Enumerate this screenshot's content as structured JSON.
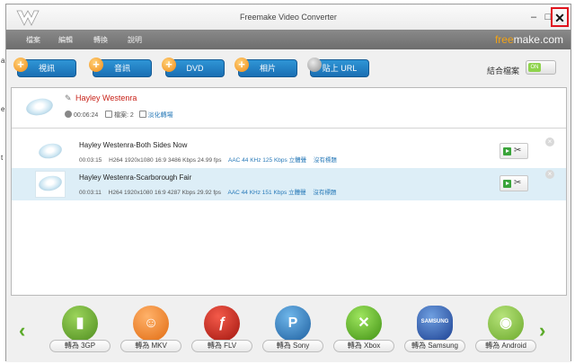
{
  "window": {
    "title": "Freemake Video Converter",
    "close_highlight_color": "#e0141e"
  },
  "menu": {
    "items": [
      "檔案",
      "編輯",
      "轉換",
      "說明"
    ],
    "brand_left": "free",
    "brand_right": "make.com"
  },
  "toolbar": {
    "buttons": [
      {
        "label": "視訊",
        "icon": "plus-icon"
      },
      {
        "label": "音訊",
        "icon": "plus-icon"
      },
      {
        "label": "DVD",
        "icon": "plus-icon"
      },
      {
        "label": "相片",
        "icon": "plus-icon"
      }
    ],
    "url_button": "貼上 URL",
    "join_label": "結合檔案",
    "join_toggle_state": "ON"
  },
  "group": {
    "title": "Hayley Westenra",
    "duration": "00:06:24",
    "files_label": "檔案: 2",
    "fade_link": "淡化轉場"
  },
  "files": [
    {
      "title": "Hayley Westenra-Both Sides Now",
      "duration": "00:03:15",
      "video": "H264  1920x1080  16:9  3486 Kbps  24.99 fps",
      "audio": "AAC  44 KHz  125 Kbps  立體聲",
      "subtitle": "沒有標題",
      "selected": false
    },
    {
      "title": "Hayley Westenra-Scarborough Fair",
      "duration": "00:03:11",
      "video": "H264  1920x1080  16:9  4287 Kbps  29.92 fps",
      "audio": "AAC  44 KHz  151 Kbps  立體聲",
      "subtitle": "沒有標題",
      "selected": true
    }
  ],
  "converters": [
    {
      "label": "轉為 3GP",
      "icon": "3gp-phone-icon"
    },
    {
      "label": "轉為 MKV",
      "icon": "mkv-matryoshka-icon"
    },
    {
      "label": "轉為 FLV",
      "icon": "flash-icon"
    },
    {
      "label": "轉為 Sony",
      "icon": "playstation-icon"
    },
    {
      "label": "轉為 Xbox",
      "icon": "xbox-icon"
    },
    {
      "label": "轉為 Samsung",
      "icon": "samsung-icon"
    },
    {
      "label": "轉為 Android",
      "icon": "android-icon"
    }
  ],
  "converter_brand_text": "SAMSUNG"
}
